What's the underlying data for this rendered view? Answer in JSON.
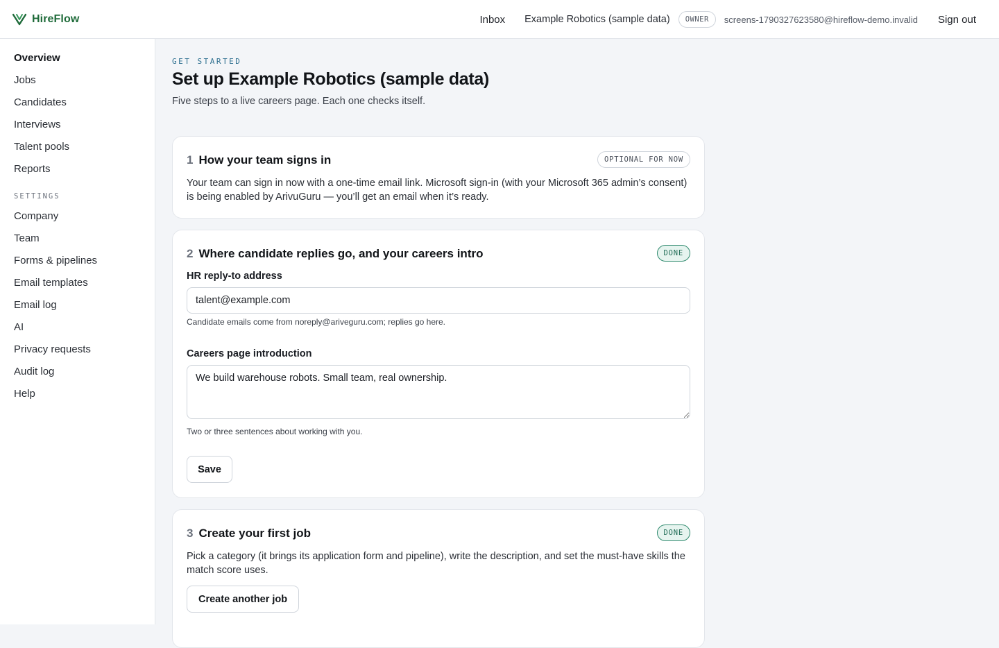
{
  "header": {
    "brand": "HireFlow",
    "inbox": "Inbox",
    "org_name": "Example Robotics (sample data)",
    "role_badge": "OWNER",
    "user_email": "screens-1790327623580@hireflow-demo.invalid",
    "sign_out": "Sign out",
    "brand_color": "#1f6b3a"
  },
  "sidebar": {
    "items": [
      {
        "label": "Overview",
        "active": true
      },
      {
        "label": "Jobs"
      },
      {
        "label": "Candidates"
      },
      {
        "label": "Interviews"
      },
      {
        "label": "Talent pools"
      },
      {
        "label": "Reports"
      }
    ],
    "settings_label": "SETTINGS",
    "settings_items": [
      {
        "label": "Company"
      },
      {
        "label": "Team"
      },
      {
        "label": "Forms & pipelines"
      },
      {
        "label": "Email templates"
      },
      {
        "label": "Email log"
      },
      {
        "label": "AI"
      },
      {
        "label": "Privacy requests"
      },
      {
        "label": "Audit log"
      },
      {
        "label": "Help"
      }
    ]
  },
  "main": {
    "eyebrow": "GET STARTED",
    "title": "Set up Example Robotics (sample data)",
    "subtitle": "Five steps to a live careers page. Each one checks itself.",
    "steps": [
      {
        "number": "1",
        "title": "How your team signs in",
        "badge": "OPTIONAL FOR NOW",
        "description": "Your team can sign in now with a one-time email link. Microsoft sign-in (with your Microsoft 365 admin’s consent) is being enabled by ArivuGuru — you’ll get an email when it’s ready."
      },
      {
        "number": "2",
        "title": "Where candidate replies go, and your careers intro",
        "badge": "DONE",
        "reply_label": "HR reply-to address",
        "reply_value": "talent@example.com",
        "reply_help": "Candidate emails come from noreply@ariveguru.com; replies go here.",
        "intro_label": "Careers page introduction",
        "intro_value": "We build warehouse robots. Small team, real ownership.",
        "intro_help": "Two or three sentences about working with you.",
        "save_label": "Save"
      },
      {
        "number": "3",
        "title": "Create your first job",
        "badge": "DONE",
        "description": "Pick a category (it brings its application form and pipeline), write the description, and set the must-have skills the match score uses.",
        "button_label": "Create another job"
      }
    ]
  }
}
